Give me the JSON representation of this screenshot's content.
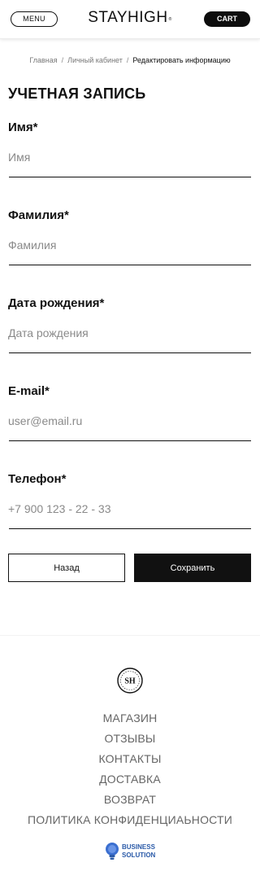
{
  "header": {
    "menu_label": "MENU",
    "logo_text": "STAYHIGH",
    "logo_mark": "®",
    "cart_label": "CART"
  },
  "breadcrumb": {
    "items": [
      "Главная",
      "Личный кабинет"
    ],
    "separator": "/",
    "current": "Редактировать информацию"
  },
  "page_title": "УЧЕТНАЯ ЗАПИСЬ",
  "form": {
    "first_name": {
      "label": "Имя*",
      "placeholder": "Имя",
      "value": ""
    },
    "last_name": {
      "label": "Фамилия*",
      "placeholder": "Фамилия",
      "value": ""
    },
    "birth_date": {
      "label": "Дата рождения*",
      "placeholder": "Дата рождения",
      "value": ""
    },
    "email": {
      "label": "E-mail*",
      "placeholder": "user@email.ru",
      "value": ""
    },
    "phone": {
      "label": "Телефон*",
      "placeholder": "+7 900 123 - 22 - 33",
      "value": ""
    },
    "back_label": "Назад",
    "save_label": "Сохранить"
  },
  "footer": {
    "logo_monogram": "SH",
    "links": [
      "МАГАЗИН",
      "ОТЗЫВЫ",
      "КОНТАКТЫ",
      "ДОСТАВКА",
      "ВОЗВРАТ",
      "ПОЛИТИКА КОНФИДЕНЦИАЬНОСТИ"
    ],
    "badge_line1": "BUSINESS",
    "badge_line2": "SOLUTION",
    "badge_icon": "lightbulb-icon"
  },
  "colors": {
    "primary": "#111111",
    "muted_text": "#666666",
    "placeholder": "#8a8a8a",
    "badge_blue": "#2a5aa8"
  }
}
